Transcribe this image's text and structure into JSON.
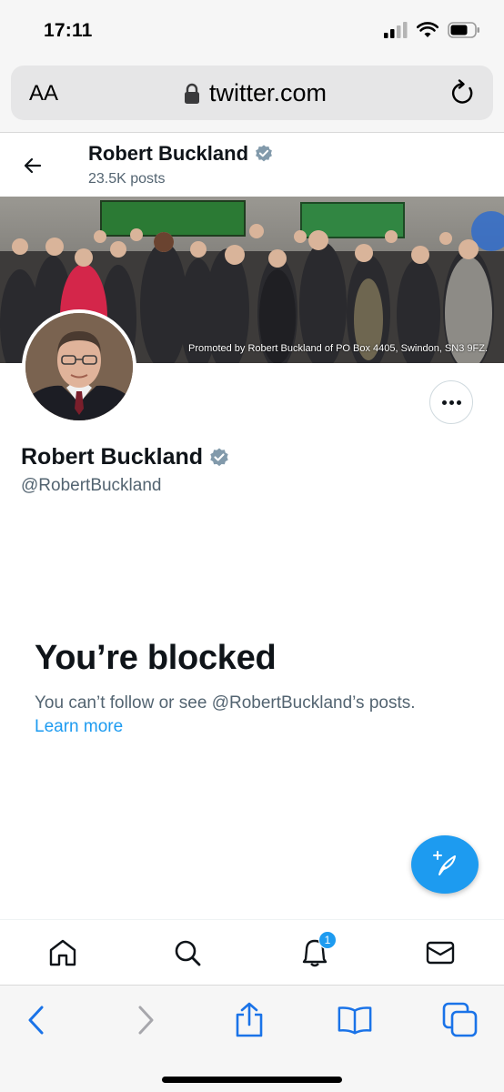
{
  "status_bar": {
    "time": "17:11"
  },
  "browser": {
    "text_size_label": "AA",
    "url": "twitter.com"
  },
  "profile_header": {
    "name": "Robert Buckland",
    "posts_count": "23.5K posts"
  },
  "banner": {
    "caption": "Promoted by Robert Buckland of PO Box 4405, Swindon, SN3 9FZ."
  },
  "profile": {
    "name": "Robert Buckland",
    "handle": "@RobertBuckland"
  },
  "blocked": {
    "title": "You’re blocked",
    "message": "You can’t follow or see @RobertBuckland’s posts.",
    "learn_more": "Learn more"
  },
  "bottom_nav": {
    "notification_count": "1"
  },
  "colors": {
    "accent": "#1d9bf0",
    "verified": "#829aab",
    "text_primary": "#0f1419",
    "text_secondary": "#536471"
  },
  "icons": {
    "back": "arrow-left-icon",
    "verified": "verified-badge-icon",
    "more": "more-horizontal-icon",
    "compose": "compose-feather-icon",
    "home": "home-icon",
    "search": "search-icon",
    "notifications": "bell-icon",
    "messages": "mail-icon"
  }
}
